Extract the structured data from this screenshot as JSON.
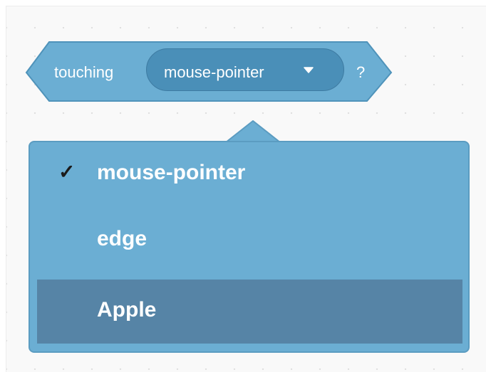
{
  "block": {
    "opcode_text": "touching",
    "menu_value": "mouse-pointer",
    "suffix": "?",
    "colors": {
      "fill": "#6baed3",
      "stroke": "#4f93ba",
      "menu_fill": "#4a8fb8",
      "text": "#ffffff"
    }
  },
  "dropdown": {
    "items": [
      {
        "label": "mouse-pointer",
        "checked": true,
        "check_glyph": "✓",
        "highlighted": false
      },
      {
        "label": "edge",
        "checked": false,
        "check_glyph": "",
        "highlighted": false
      },
      {
        "label": "Apple",
        "checked": false,
        "check_glyph": "",
        "highlighted": true
      }
    ],
    "colors": {
      "background": "#6baed3",
      "border": "#5b9cc1",
      "highlight": "#5684a6",
      "check": "#1b1b1b"
    },
    "icons": {
      "checkmark": "check-icon",
      "caret": "chevron-down-icon"
    }
  }
}
